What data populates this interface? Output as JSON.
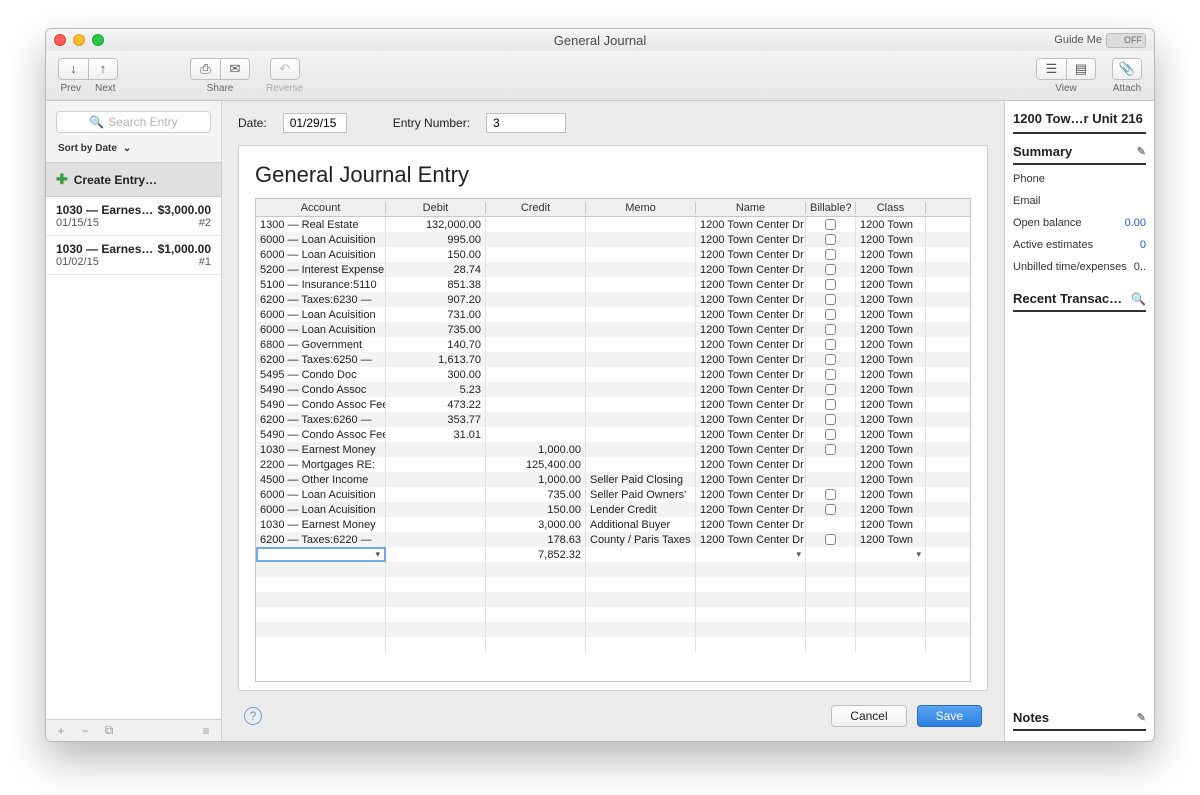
{
  "window_title": "General Journal",
  "guide_label": "Guide Me",
  "guide_toggle": "OFF",
  "toolbar": {
    "prev": "Prev",
    "next": "Next",
    "share": "Share",
    "reverse": "Reverse",
    "view": "View",
    "attach": "Attach"
  },
  "sidebar_left": {
    "search_placeholder": "Search Entry",
    "sort_label": "Sort by Date",
    "create_label": "Create Entry…",
    "entries": [
      {
        "acct": "1030 — Earnest…",
        "amount": "$3,000.00",
        "date": "01/15/15",
        "num": "#2"
      },
      {
        "acct": "1030 — Earnest…",
        "amount": "$1,000.00",
        "date": "01/02/15",
        "num": "#1"
      }
    ]
  },
  "form": {
    "date_label": "Date:",
    "date_value": "01/29/15",
    "entry_number_label": "Entry Number:",
    "entry_number_value": "3",
    "title": "General Journal Entry",
    "columns": [
      "Account",
      "Debit",
      "Credit",
      "Memo",
      "Name",
      "Billable?",
      "Class"
    ],
    "rows": [
      {
        "account": "1300 — Real Estate",
        "debit": "132,000.00",
        "credit": "",
        "memo": "",
        "name": "1200 Town Center Dr",
        "billable": true,
        "class": "1200 Town"
      },
      {
        "account": "6000 — Loan Acuisition",
        "debit": "995.00",
        "credit": "",
        "memo": "",
        "name": "1200 Town Center Dr",
        "billable": true,
        "class": "1200 Town"
      },
      {
        "account": "6000 — Loan Acuisition",
        "debit": "150.00",
        "credit": "",
        "memo": "",
        "name": "1200 Town Center Dr",
        "billable": true,
        "class": "1200 Town"
      },
      {
        "account": "5200 — Interest Expense:",
        "debit": "28.74",
        "credit": "",
        "memo": "",
        "name": "1200 Town Center Dr",
        "billable": true,
        "class": "1200 Town"
      },
      {
        "account": "5100 — Insurance:5110",
        "debit": "851.38",
        "credit": "",
        "memo": "",
        "name": "1200 Town Center Dr",
        "billable": true,
        "class": "1200 Town"
      },
      {
        "account": "6200 — Taxes:6230 —",
        "debit": "907.20",
        "credit": "",
        "memo": "",
        "name": "1200 Town Center Dr",
        "billable": true,
        "class": "1200 Town"
      },
      {
        "account": "6000 — Loan Acuisition",
        "debit": "731.00",
        "credit": "",
        "memo": "",
        "name": "1200 Town Center Dr",
        "billable": true,
        "class": "1200 Town"
      },
      {
        "account": "6000 — Loan Acuisition",
        "debit": "735.00",
        "credit": "",
        "memo": "",
        "name": "1200 Town Center Dr",
        "billable": true,
        "class": "1200 Town"
      },
      {
        "account": "6800 — Government",
        "debit": "140.70",
        "credit": "",
        "memo": "",
        "name": "1200 Town Center Dr",
        "billable": true,
        "class": "1200 Town"
      },
      {
        "account": "6200 — Taxes:6250 —",
        "debit": "1,613.70",
        "credit": "",
        "memo": "",
        "name": "1200 Town Center Dr",
        "billable": true,
        "class": "1200 Town"
      },
      {
        "account": "5495 — Condo Doc",
        "debit": "300.00",
        "credit": "",
        "memo": "",
        "name": "1200 Town Center Dr",
        "billable": true,
        "class": "1200 Town"
      },
      {
        "account": "5490 — Condo Assoc",
        "debit": "5.23",
        "credit": "",
        "memo": "",
        "name": "1200 Town Center Dr",
        "billable": true,
        "class": "1200 Town"
      },
      {
        "account": "5490 — Condo Assoc Fee",
        "debit": "473.22",
        "credit": "",
        "memo": "",
        "name": "1200 Town Center Dr",
        "billable": true,
        "class": "1200 Town"
      },
      {
        "account": "6200 — Taxes:6260 —",
        "debit": "353.77",
        "credit": "",
        "memo": "",
        "name": "1200 Town Center Dr",
        "billable": true,
        "class": "1200 Town"
      },
      {
        "account": "5490 — Condo Assoc Fee",
        "debit": "31.01",
        "credit": "",
        "memo": "",
        "name": "1200 Town Center Dr",
        "billable": true,
        "class": "1200 Town"
      },
      {
        "account": "1030 — Earnest Money",
        "debit": "",
        "credit": "1,000.00",
        "memo": "",
        "name": "1200 Town Center Dr",
        "billable": true,
        "class": "1200 Town"
      },
      {
        "account": "2200 — Mortgages RE:",
        "debit": "",
        "credit": "125,400.00",
        "memo": "",
        "name": "1200 Town Center Dr",
        "billable": false,
        "class": "1200 Town"
      },
      {
        "account": "4500 — Other Income",
        "debit": "",
        "credit": "1,000.00",
        "memo": "Seller Paid Closing",
        "name": "1200 Town Center Dr",
        "billable": false,
        "class": "1200 Town"
      },
      {
        "account": "6000 — Loan Acuisition",
        "debit": "",
        "credit": "735.00",
        "memo": "Seller Paid Owners'",
        "name": "1200 Town Center Dr",
        "billable": true,
        "class": "1200 Town"
      },
      {
        "account": "6000 — Loan Acuisition",
        "debit": "",
        "credit": "150.00",
        "memo": "Lender Credit",
        "name": "1200 Town Center Dr",
        "billable": true,
        "class": "1200 Town"
      },
      {
        "account": "1030 — Earnest Money",
        "debit": "",
        "credit": "3,000.00",
        "memo": "Additional Buyer",
        "name": "1200 Town Center Dr",
        "billable": false,
        "class": "1200 Town"
      },
      {
        "account": "6200 — Taxes:6220 —",
        "debit": "",
        "credit": "178.63",
        "memo": "County / Paris Taxes",
        "name": "1200 Town Center Dr",
        "billable": true,
        "class": "1200 Town"
      }
    ],
    "editing_credit": "7,852.32"
  },
  "buttons": {
    "cancel": "Cancel",
    "save": "Save"
  },
  "sidebar_right": {
    "title": "1200 Tow…r Unit 216",
    "summary_label": "Summary",
    "phone_label": "Phone",
    "email_label": "Email",
    "open_balance_label": "Open balance",
    "open_balance_value": "0.00",
    "active_est_label": "Active estimates",
    "active_est_value": "0",
    "unbilled_label": "Unbilled time/expenses",
    "unbilled_value": "0..",
    "recent_label": "Recent Transac…",
    "notes_label": "Notes"
  }
}
